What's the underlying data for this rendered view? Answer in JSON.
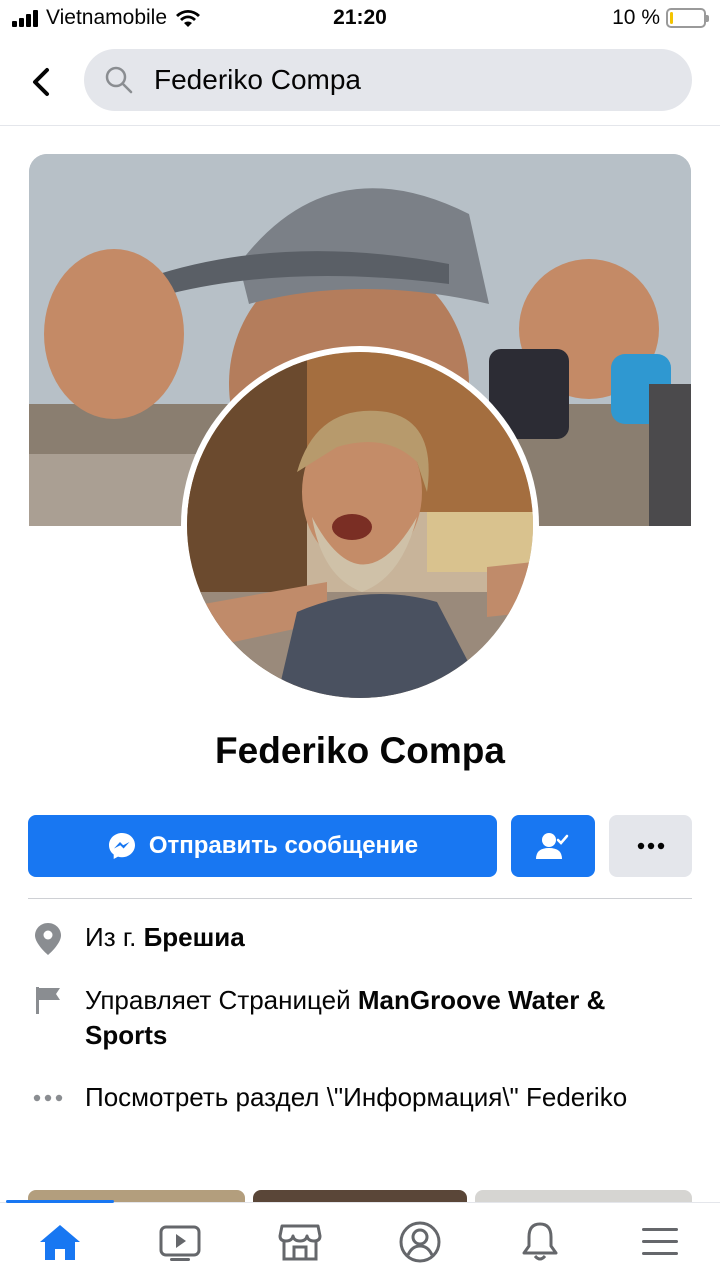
{
  "status_bar": {
    "carrier": "Vietnamobile",
    "time": "21:20",
    "battery_percent_label": "10 %",
    "battery_level": 0.1
  },
  "header": {
    "search_value": "Federiko Compa",
    "back_icon": "chevron-left-icon",
    "search_icon": "search-icon"
  },
  "profile": {
    "name": "Federiko Compa"
  },
  "actions": {
    "message_label": "Отправить сообщение",
    "message_icon": "messenger-icon",
    "friend_icon": "friend-check-icon",
    "more_icon": "more-dots-icon"
  },
  "info": {
    "from_prefix": "Из г. ",
    "from_city": "Брешиа",
    "manages_prefix": "Управляет Страницей ",
    "manages_page": "ManGroove Water & Sports",
    "about_link": "Посмотреть раздел \\\"Информация\\\" Federiko"
  },
  "tabs": [
    {
      "name": "home",
      "icon": "home-icon",
      "active": true
    },
    {
      "name": "watch",
      "icon": "video-icon",
      "active": false
    },
    {
      "name": "marketplace",
      "icon": "marketplace-icon",
      "active": false
    },
    {
      "name": "profile",
      "icon": "profile-icon",
      "active": false
    },
    {
      "name": "notifications",
      "icon": "bell-icon",
      "active": false
    },
    {
      "name": "menu",
      "icon": "menu-icon",
      "active": false
    }
  ],
  "colors": {
    "accent": "#1877f2",
    "secondary_button": "#e4e6eb",
    "icon_gray": "#65676b"
  }
}
